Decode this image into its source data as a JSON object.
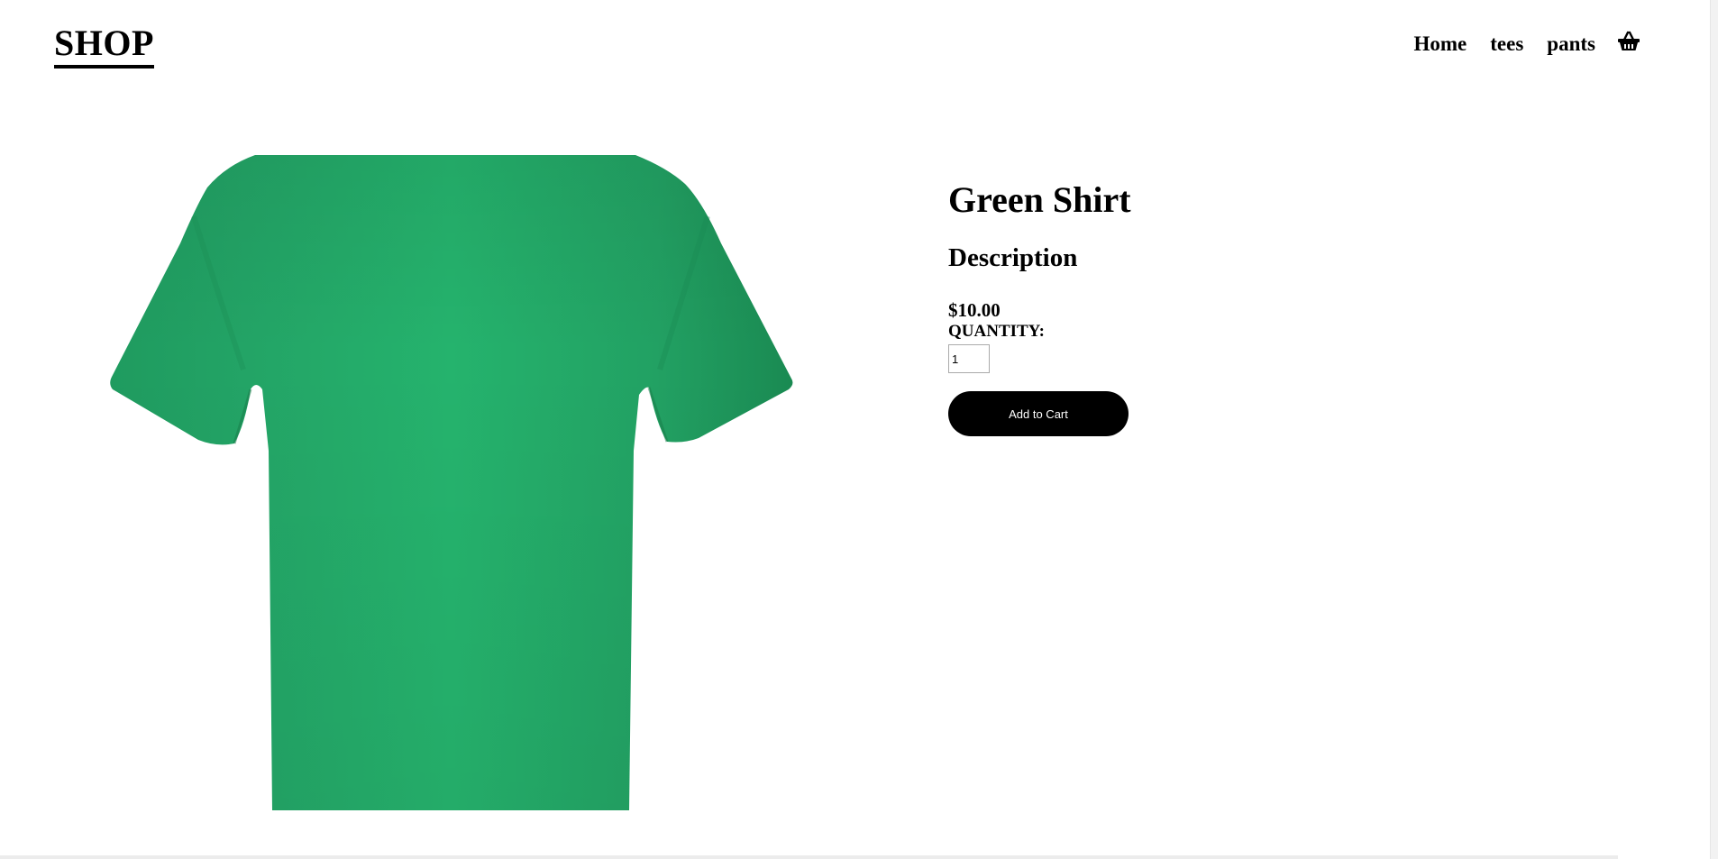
{
  "header": {
    "logo": "SHOP",
    "nav": {
      "home": "Home",
      "tees": "tees",
      "pants": "pants"
    },
    "cart_icon": "shopping-basket-icon"
  },
  "product": {
    "title": "Green Shirt",
    "description": "Description",
    "price": "$10.00",
    "quantity_label": "QUANTITY:",
    "quantity_value": "1",
    "add_to_cart_label": "Add to Cart",
    "image_color": "#23a466"
  }
}
